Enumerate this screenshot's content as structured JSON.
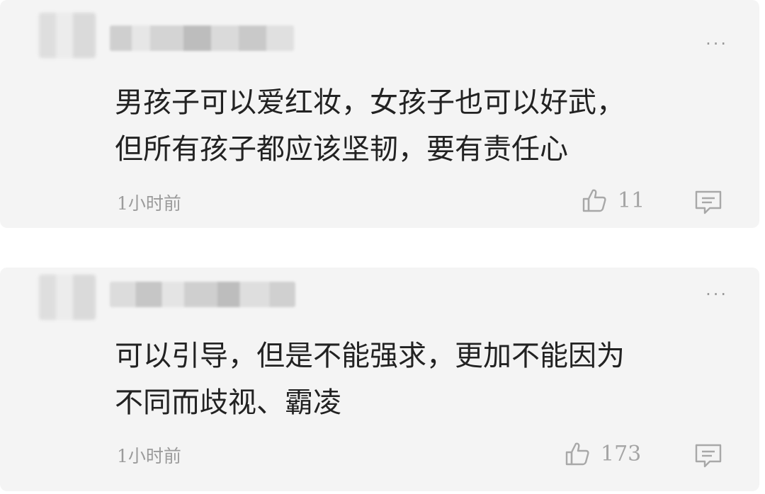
{
  "comments": [
    {
      "text": "男孩子可以爱红妆，女孩子也可以好武，\n但所有孩子都应该坚韧，要有责任心",
      "time": "1小时前",
      "likes": "11",
      "icons": {
        "more": "more-dots-icon",
        "like": "thumbs-up-icon",
        "reply": "comment-icon"
      }
    },
    {
      "text": "可以引导，但是不能强求，更加不能因为\n不同而歧视、霸凌",
      "time": "1小时前",
      "likes": "173",
      "icons": {
        "more": "more-dots-icon",
        "like": "thumbs-up-icon",
        "reply": "comment-icon"
      }
    }
  ],
  "more_glyph": "···",
  "colors": {
    "card_bg": "#f4f4f4",
    "text": "#222222",
    "meta": "#9b9b9b"
  }
}
